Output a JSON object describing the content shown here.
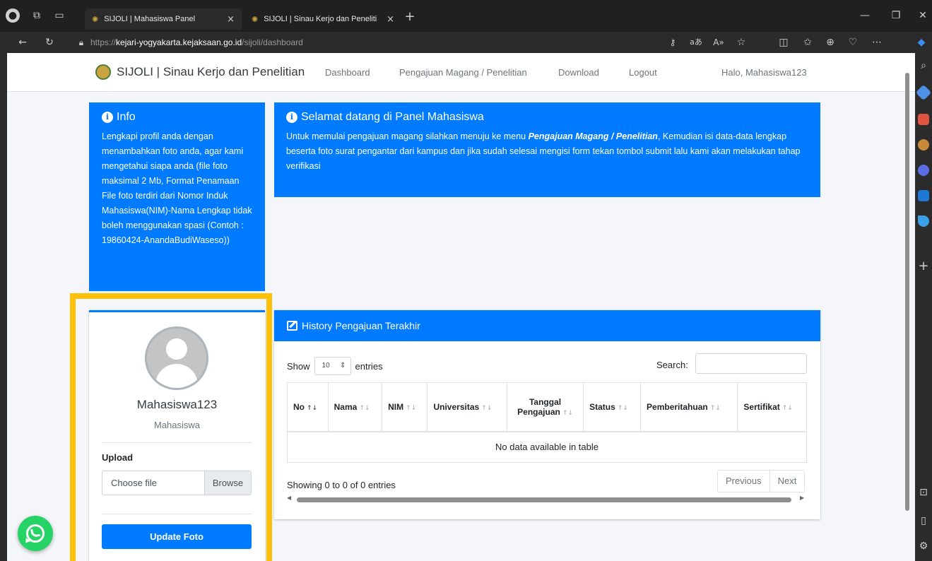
{
  "browser": {
    "tabs": [
      {
        "title": "SIJOLI | Mahasiswa Panel",
        "close": "×"
      },
      {
        "title": "SIJOLI | Sinau Kerjo dan Penelitian",
        "close": "×"
      }
    ],
    "new_tab": "+",
    "url_prefix": "https://",
    "url_host": "kejari-yogyakarta.kejaksaan.go.id",
    "url_path": "/sijoli/dashboard",
    "window_controls": {
      "minimize": "—",
      "restore": "❐",
      "close": "✕"
    }
  },
  "nav": {
    "brand": "SIJOLI | Sinau Kerjo dan Penelitian",
    "links": [
      "Dashboard",
      "Pengajuan Magang / Penelitian",
      "Download",
      "Logout"
    ],
    "greeting": "Halo, Mahasiswa123"
  },
  "info_card": {
    "icon_char": "i",
    "title": "Info",
    "body": "Lengkapi profil anda dengan menambahkan foto anda, agar kami mengetahui siapa anda (file foto maksimal 2 Mb, Format Penamaan File foto terdiri dari Nomor Induk Mahasiswa(NIM)-Nama Lengkap tidak boleh menggunakan spasi (Contoh : 19860424-AnandaBudiWaseso))"
  },
  "welcome_card": {
    "icon_char": "i",
    "title": "Selamat datang di Panel Mahasiswa",
    "body_before": "Untuk memulai pengajuan magang silahkan menuju ke menu ",
    "body_link": "Pengajuan Magang / Penelitian",
    "body_after": ", Kemudian isi data-data lengkap beserta foto surat pengantar dari kampus dan jika sudah selesai mengisi form tekan tombol submit lalu kami akan melakukan tahap verifikasi"
  },
  "profile": {
    "name": "Mahasiswa123",
    "role": "Mahasiswa",
    "upload_label": "Upload",
    "file_placeholder": "Choose file",
    "browse_label": "Browse",
    "update_button": "Update Foto"
  },
  "history": {
    "title": "History Pengajuan Terakhir",
    "show_label": "Show",
    "entries_value": "10",
    "entries_label": "entries",
    "search_label": "Search:",
    "columns": [
      {
        "line1": "",
        "line2": "No",
        "sort": "↑↓"
      },
      {
        "line1": "",
        "line2": "Nama",
        "sort": "↑↓"
      },
      {
        "line1": "",
        "line2": "NIM",
        "sort": "↑↓"
      },
      {
        "line1": "",
        "line2": "Universitas",
        "sort": "↑↓"
      },
      {
        "line1": "Tanggal",
        "line2": "Pengajuan",
        "sort": "↑↓"
      },
      {
        "line1": "",
        "line2": "Status",
        "sort": "↑↓"
      },
      {
        "line1": "",
        "line2": "Pemberitahuan",
        "sort": "↑↓"
      },
      {
        "line1": "",
        "line2": "Sertifikat",
        "sort": "↑↓"
      }
    ],
    "empty_message": "No data available in table",
    "showing": "Showing 0 to 0 of 0 entries",
    "previous": "Previous",
    "next": "Next"
  },
  "colors": {
    "primary": "#007bff",
    "highlight": "#ffc107",
    "whatsapp": "#25d366"
  }
}
